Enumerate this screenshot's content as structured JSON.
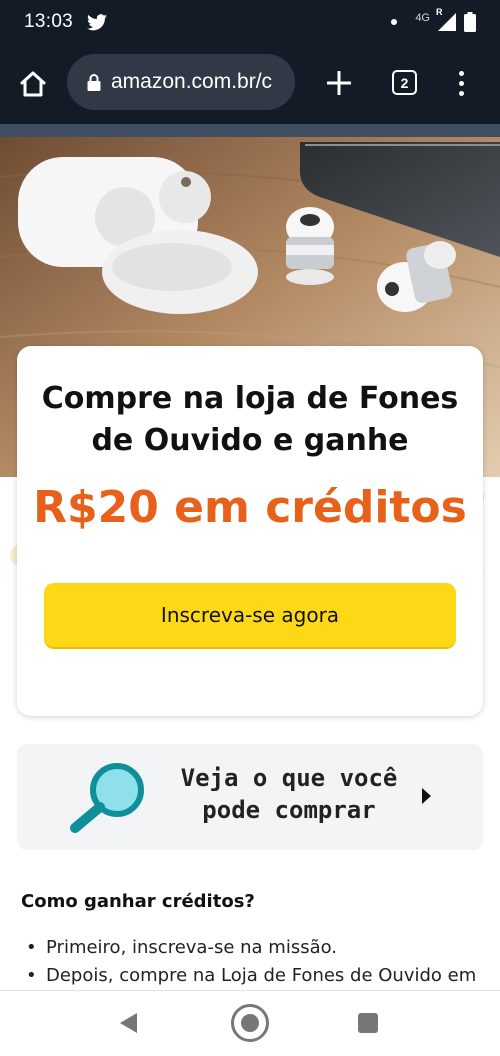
{
  "status_bar": {
    "time": "13:03",
    "network": "4G",
    "roaming": "R",
    "icons": [
      "twitter-icon",
      "notification-dot-icon",
      "signal-icon",
      "battery-icon"
    ]
  },
  "browser": {
    "url": "amazon.com.br/c",
    "tab_count": "2",
    "icons": [
      "home-icon",
      "lock-icon",
      "new-tab-icon",
      "tabs-icon",
      "menu-icon"
    ]
  },
  "promo": {
    "title": "Compre na loja de Fones de Ouvido e ganhe",
    "amount": "R$20 em créditos",
    "button_label": "Inscreva-se agora",
    "colors": {
      "amount": "#e8611a",
      "button": "#fdd817"
    }
  },
  "search_card": {
    "line1": "Veja o que você",
    "line2": "pode comprar",
    "icons": [
      "magnifier-icon",
      "chevron-right-icon"
    ]
  },
  "how_to": {
    "title": "Como ganhar créditos?",
    "steps": [
      "Primeiro, inscreva-se na missão.",
      "Depois, compre na Loja de Fones de Ouvido em"
    ]
  },
  "nav_bar": {
    "icons": [
      "back-icon",
      "home-circle-icon",
      "recents-icon"
    ]
  }
}
